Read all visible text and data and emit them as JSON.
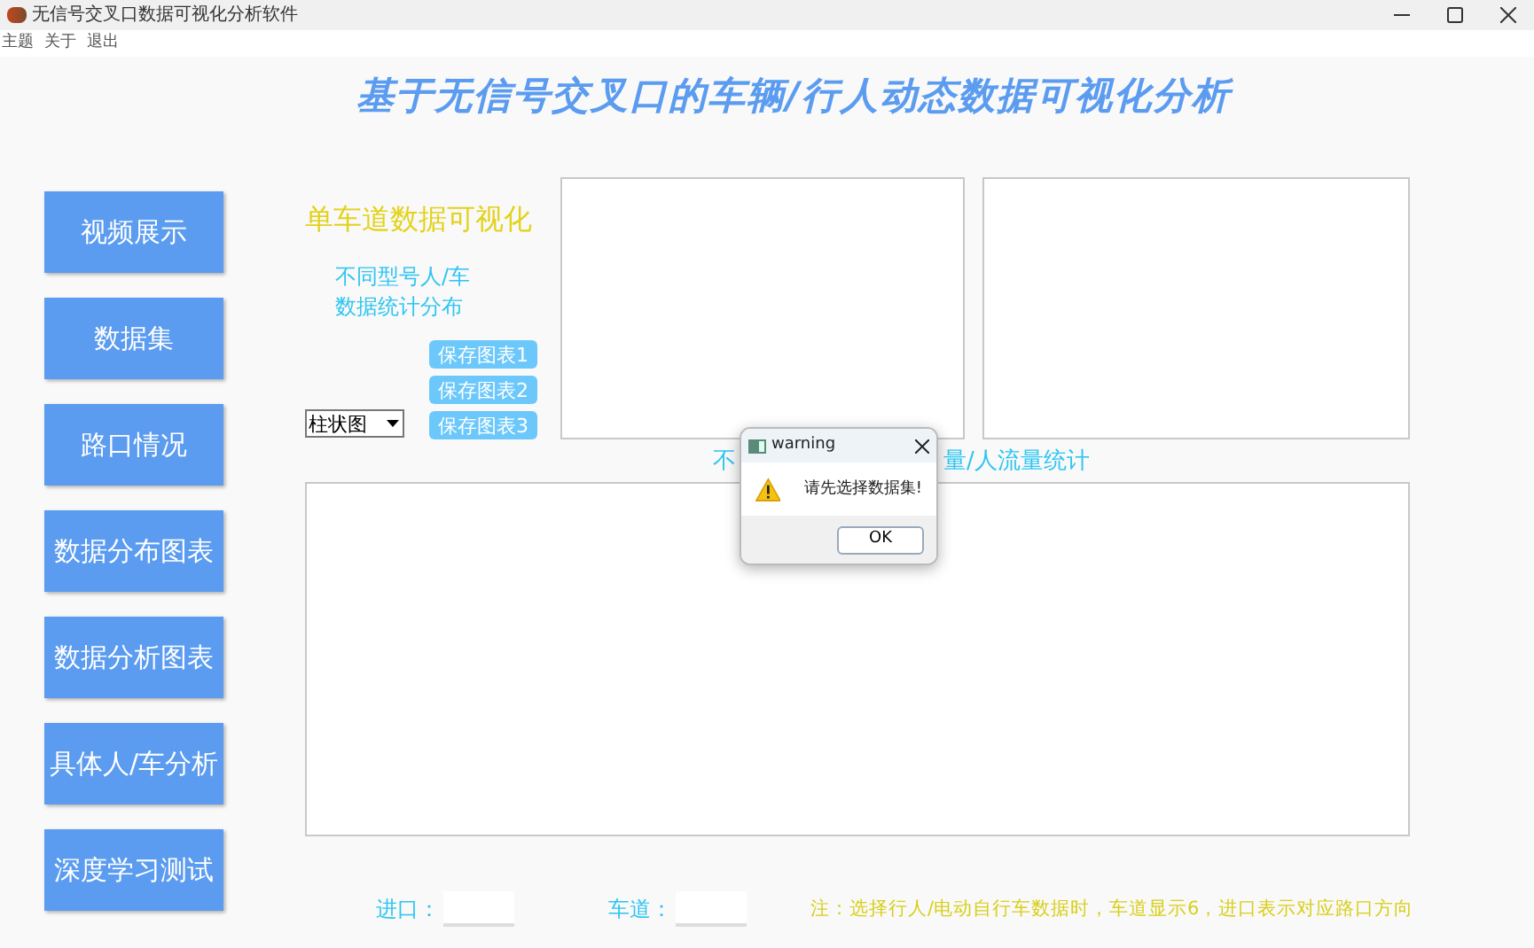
{
  "window": {
    "title": "无信号交叉口数据可视化分析软件"
  },
  "menu": [
    "主题",
    "关于",
    "退出"
  ],
  "heading": "基于无信号交叉口的车辆/行人动态数据可视化分析",
  "sidebar": {
    "items": [
      "视频展示",
      "数据集",
      "路口情况",
      "数据分布图表",
      "数据分析图表",
      "具体人/车分析",
      "深度学习测试"
    ]
  },
  "panel": {
    "title": "单车道数据可视化",
    "subtitle": [
      "不同型号人/车",
      "数据统计分布"
    ],
    "save_buttons": [
      "保存图表1",
      "保存图表2",
      "保存图表3"
    ],
    "chart_type": {
      "value": "柱状图"
    }
  },
  "chart_label_parts": [
    "不",
    "量/人流量统计"
  ],
  "footer": {
    "entry_label": "进口：",
    "lane_label": "车道：",
    "note": "注：选择行人/电动自行车数据时，车道显示6，进口表示对应路口方向"
  },
  "dialog": {
    "title": "warning",
    "message": "请先选择数据集!",
    "button": "OK"
  }
}
